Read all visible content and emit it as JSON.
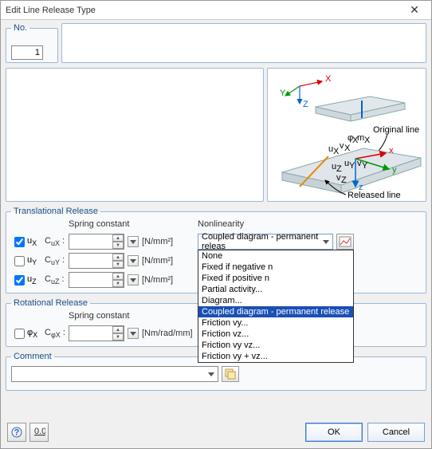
{
  "window_title": "Edit Line Release Type",
  "no_label": "No.",
  "no_value": "1",
  "diagram_labels": {
    "original_line": "Original line",
    "released_line": "Released line"
  },
  "translational_release": {
    "legend": "Translational Release",
    "spring_header": "Spring constant",
    "nonlinearity_header": "Nonlinearity",
    "unit": "[N/mm²]",
    "rows": [
      {
        "dof_base": "u",
        "dof_sub": "X",
        "spring_label_base": "C",
        "spring_label_sub": "uX",
        "spring_value": ""
      },
      {
        "dof_base": "u",
        "dof_sub": "Y",
        "spring_label_base": "C",
        "spring_label_sub": "uY",
        "spring_value": ""
      },
      {
        "dof_base": "u",
        "dof_sub": "Z",
        "spring_label_base": "C",
        "spring_label_sub": "uZ",
        "spring_value": ""
      }
    ]
  },
  "rotational_release": {
    "legend": "Rotational Release",
    "spring_header": "Spring constant",
    "unit": "[Nm/rad/mm]",
    "rows": [
      {
        "dof_base": "φ",
        "dof_sub": "X",
        "spring_label_base": "C",
        "spring_label_sub": "φX",
        "spring_value": ""
      }
    ]
  },
  "nonlinearity": {
    "selected": "Coupled diagram - permanent releas",
    "options": [
      "None",
      "Fixed if negative n",
      "Fixed if positive n",
      "Partial activity...",
      "Diagram...",
      "Coupled diagram - permanent release",
      "Friction vy...",
      "Friction vz...",
      "Friction vy vz...",
      "Friction vy + vz..."
    ]
  },
  "comment": {
    "legend": "Comment",
    "value": ""
  },
  "buttons": {
    "ok": "OK",
    "cancel": "Cancel"
  }
}
